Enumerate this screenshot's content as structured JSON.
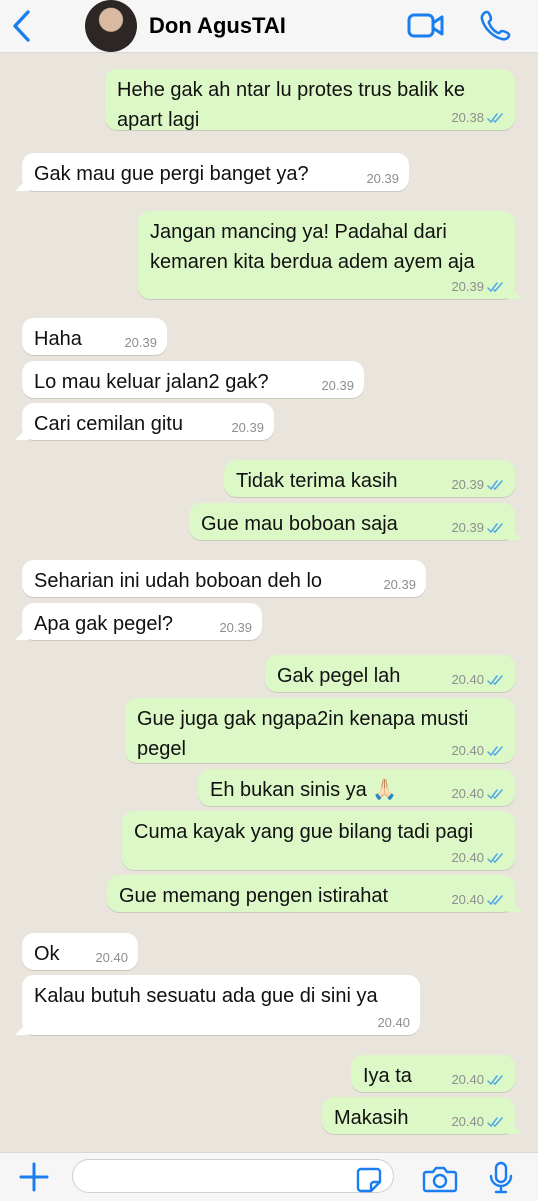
{
  "header": {
    "contact_name": "Don AgusTAI",
    "accent_color": "#1a7ef0",
    "icons": [
      "chevron-left-icon",
      "avatar",
      "video-call-icon",
      "phone-icon"
    ]
  },
  "messages": [
    {
      "direction": "out",
      "text": "Hehe gak ah ntar lu protes trus balik ke apart lagi",
      "time": "20.38",
      "read": true
    },
    {
      "direction": "in",
      "text": "Gak mau gue pergi banget ya?",
      "time": "20.39"
    },
    {
      "direction": "out",
      "text": "Jangan mancing ya! Padahal dari kemaren kita berdua adem ayem aja",
      "time": "20.39",
      "read": true
    },
    {
      "direction": "in",
      "text": "Haha",
      "time": "20.39"
    },
    {
      "direction": "in",
      "text": "Lo mau keluar jalan2 gak?",
      "time": "20.39"
    },
    {
      "direction": "in",
      "text": "Cari cemilan gitu",
      "time": "20.39"
    },
    {
      "direction": "out",
      "text": "Tidak terima kasih",
      "time": "20.39",
      "read": true
    },
    {
      "direction": "out",
      "text": "Gue mau boboan saja",
      "time": "20.39",
      "read": true
    },
    {
      "direction": "in",
      "text": "Seharian ini udah boboan deh lo",
      "time": "20.39"
    },
    {
      "direction": "in",
      "text": "Apa gak pegel?",
      "time": "20.39"
    },
    {
      "direction": "out",
      "text": "Gak pegel lah",
      "time": "20.40",
      "read": true
    },
    {
      "direction": "out",
      "text": "Gue juga gak ngapa2in kenapa musti pegel",
      "time": "20.40",
      "read": true
    },
    {
      "direction": "out",
      "text": "Eh bukan sinis ya 🙏🏻",
      "time": "20.40",
      "read": true
    },
    {
      "direction": "out",
      "text": "Cuma kayak yang gue bilang tadi pagi",
      "time": "20.40",
      "read": true
    },
    {
      "direction": "out",
      "text": "Gue memang pengen istirahat",
      "time": "20.40",
      "read": true
    },
    {
      "direction": "in",
      "text": "Ok",
      "time": "20.40"
    },
    {
      "direction": "in",
      "text": "Kalau butuh sesuatu ada gue di sini ya",
      "time": "20.40"
    },
    {
      "direction": "out",
      "text": "Iya ta",
      "time": "20.40",
      "read": true
    },
    {
      "direction": "out",
      "text": "Makasih",
      "time": "20.40",
      "read": true
    }
  ],
  "composer": {
    "input_value": "",
    "icons": [
      "plus-icon",
      "sticker-icon",
      "camera-icon",
      "microphone-icon"
    ]
  }
}
